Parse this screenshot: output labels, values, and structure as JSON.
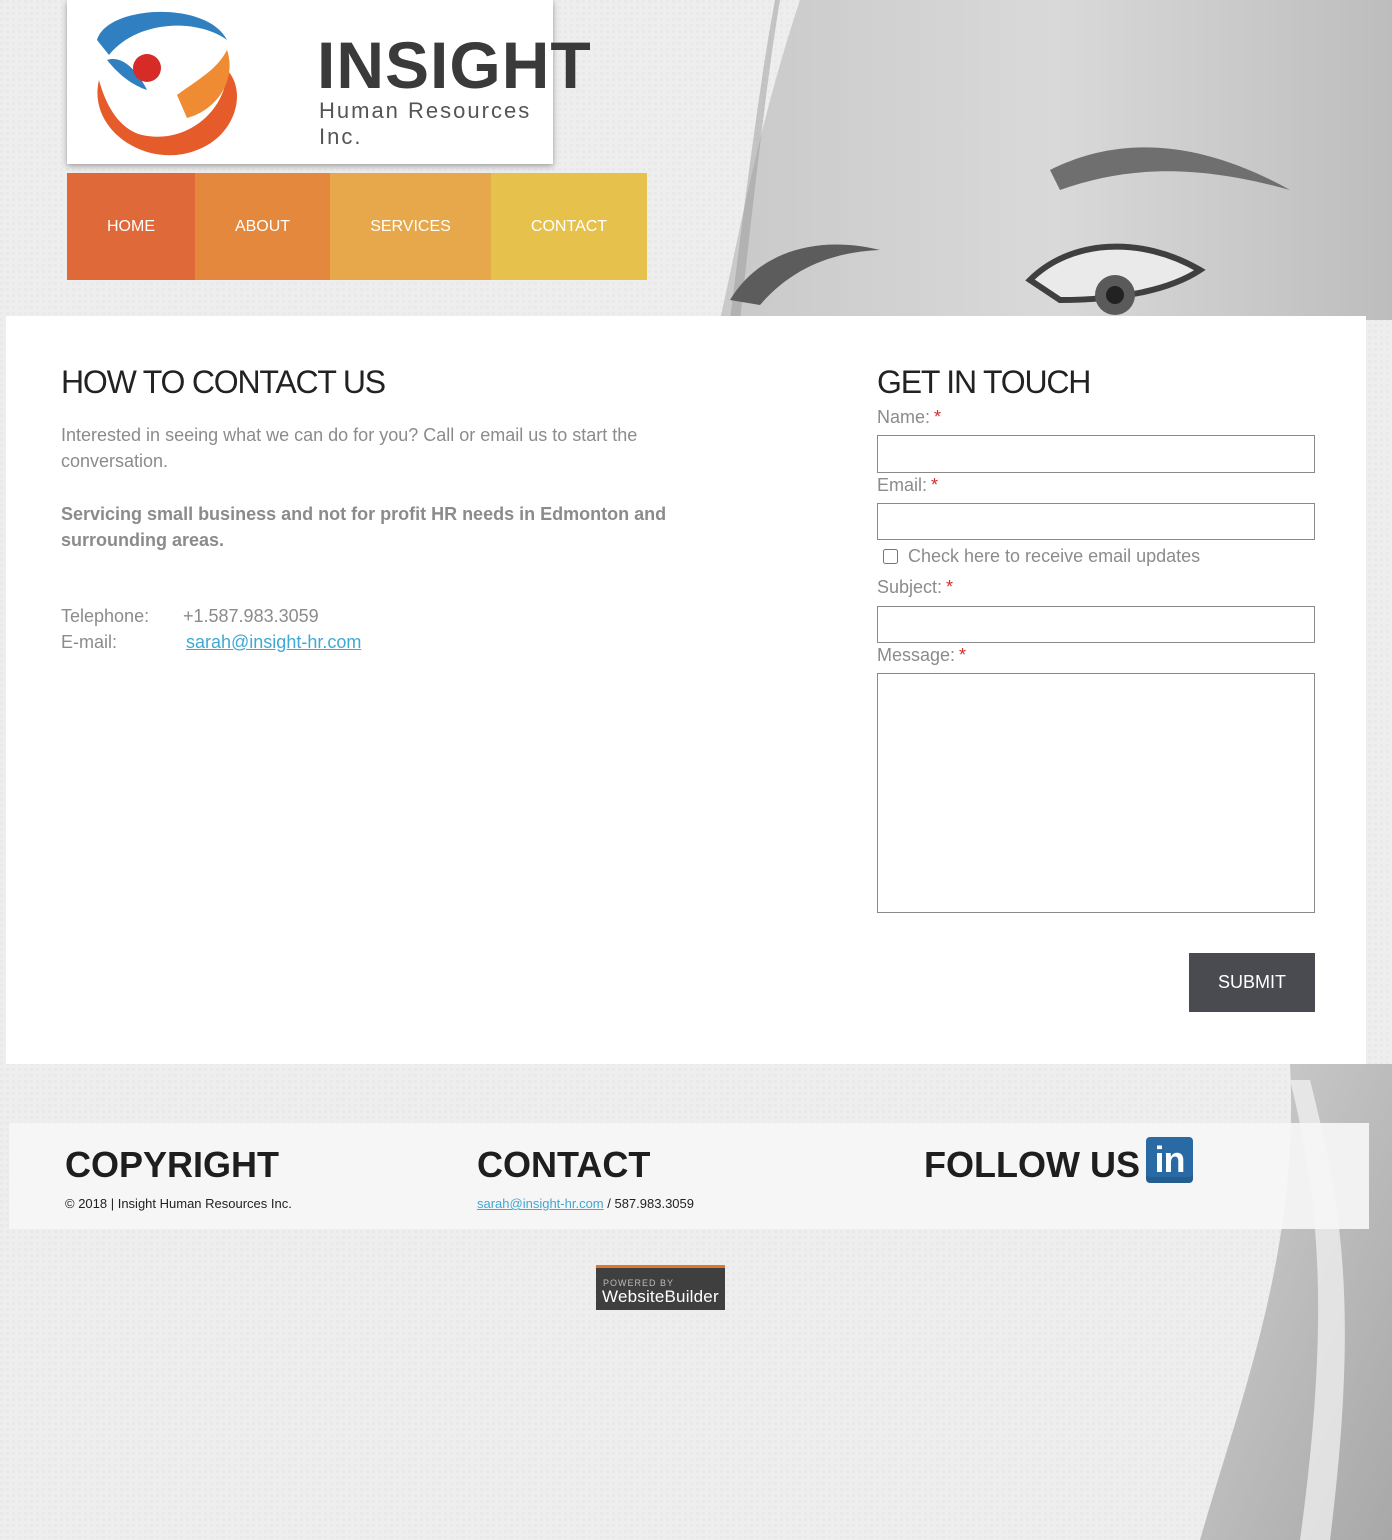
{
  "logo": {
    "title": "INSIGHT",
    "subtitle": "Human Resources Inc."
  },
  "nav": {
    "items": [
      {
        "label": "HOME",
        "color": "#e0693a"
      },
      {
        "label": "ABOUT",
        "color": "#e3883c"
      },
      {
        "label": "SERVICES",
        "color": "#e6a84a"
      },
      {
        "label": "CONTACT",
        "color": "#e6c24c"
      }
    ]
  },
  "contact_info": {
    "heading": "HOW TO CONTACT US",
    "intro": "Interested in seeing what we can do for you? Call or email us to start the conversation.",
    "servicing": "Servicing small business and not for profit HR needs in Edmonton and surrounding areas.",
    "telephone_label": "Telephone:",
    "telephone_value": "+1.587.983.3059",
    "email_label": "E-mail:",
    "email_value": "sarah@insight-hr.com"
  },
  "form": {
    "heading": "GET IN TOUCH",
    "name_label": "Name:",
    "email_label": "Email:",
    "checkbox_label": "Check here to receive email updates",
    "subject_label": "Subject:",
    "message_label": "Message:",
    "required_marker": "*",
    "name_value": "",
    "email_value": "",
    "subject_value": "",
    "message_value": "",
    "submit_label": "SUBMIT"
  },
  "footer": {
    "copyright_heading": "COPYRIGHT",
    "copyright_text": "© 2018 | Insight Human Resources Inc.",
    "contact_heading": "CONTACT",
    "contact_email": "sarah@insight-hr.com",
    "contact_phone": " / 587.983.3059",
    "follow_heading": "FOLLOW US",
    "linkedin_icon": "linkedin-icon",
    "linkedin_text": "in"
  },
  "powered_by": {
    "line1": "POWERED BY",
    "line2": "WebsiteBuilder"
  },
  "colors": {
    "accent_link": "#3fa8d4",
    "required": "#d42b2b",
    "submit_bg": "#4a4b50"
  }
}
